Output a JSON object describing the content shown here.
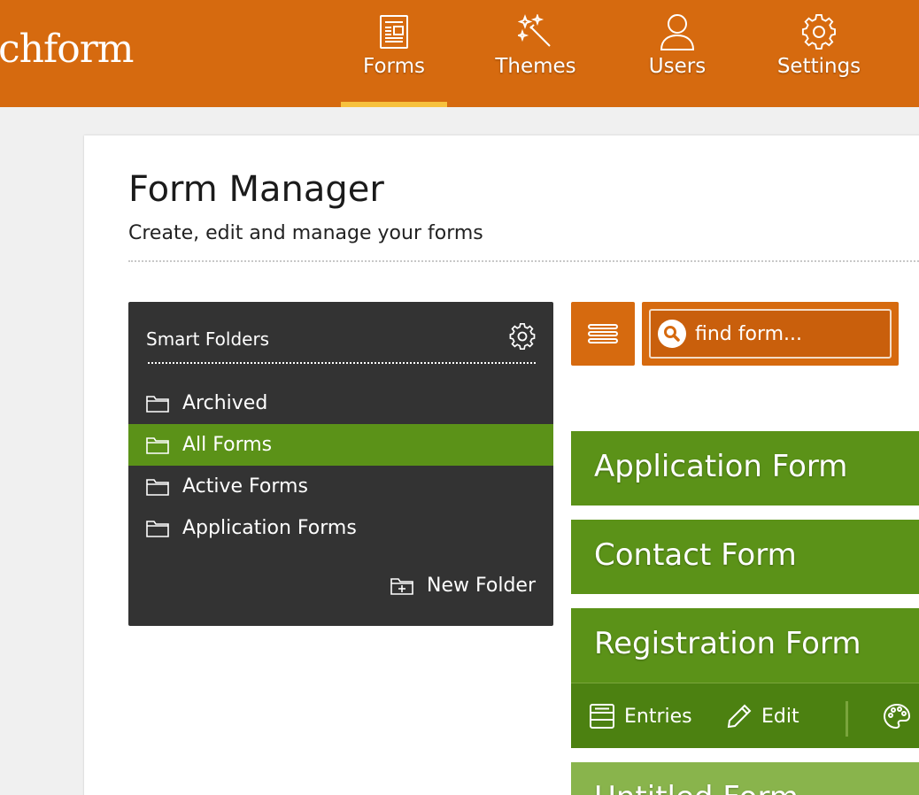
{
  "app": {
    "logo_text": "chform"
  },
  "nav": {
    "items": [
      {
        "label": "Forms",
        "icon": "forms-icon",
        "active": true
      },
      {
        "label": "Themes",
        "icon": "magic-wand-icon",
        "active": false
      },
      {
        "label": "Users",
        "icon": "user-icon",
        "active": false
      },
      {
        "label": "Settings",
        "icon": "gear-icon",
        "active": false
      }
    ]
  },
  "page": {
    "title": "Form Manager",
    "subtitle": "Create, edit and manage your forms"
  },
  "folders": {
    "title": "Smart Folders",
    "items": [
      {
        "label": "Archived",
        "active": false
      },
      {
        "label": "All Forms",
        "active": true
      },
      {
        "label": "Active Forms",
        "active": false
      },
      {
        "label": "Application Forms",
        "active": false
      }
    ],
    "new_folder_label": "New Folder"
  },
  "search": {
    "placeholder": "find form..."
  },
  "forms": [
    {
      "name": "Application Form"
    },
    {
      "name": "Contact Form"
    },
    {
      "name": "Registration Form"
    },
    {
      "name": "Untitled Form"
    }
  ],
  "form_actions": {
    "entries_label": "Entries",
    "edit_label": "Edit"
  },
  "colors": {
    "header_orange": "#d66a0f",
    "active_underline": "#f7c13d",
    "folder_panel": "#333333",
    "active_green": "#5b9218",
    "untitled_green": "#89b44c"
  }
}
